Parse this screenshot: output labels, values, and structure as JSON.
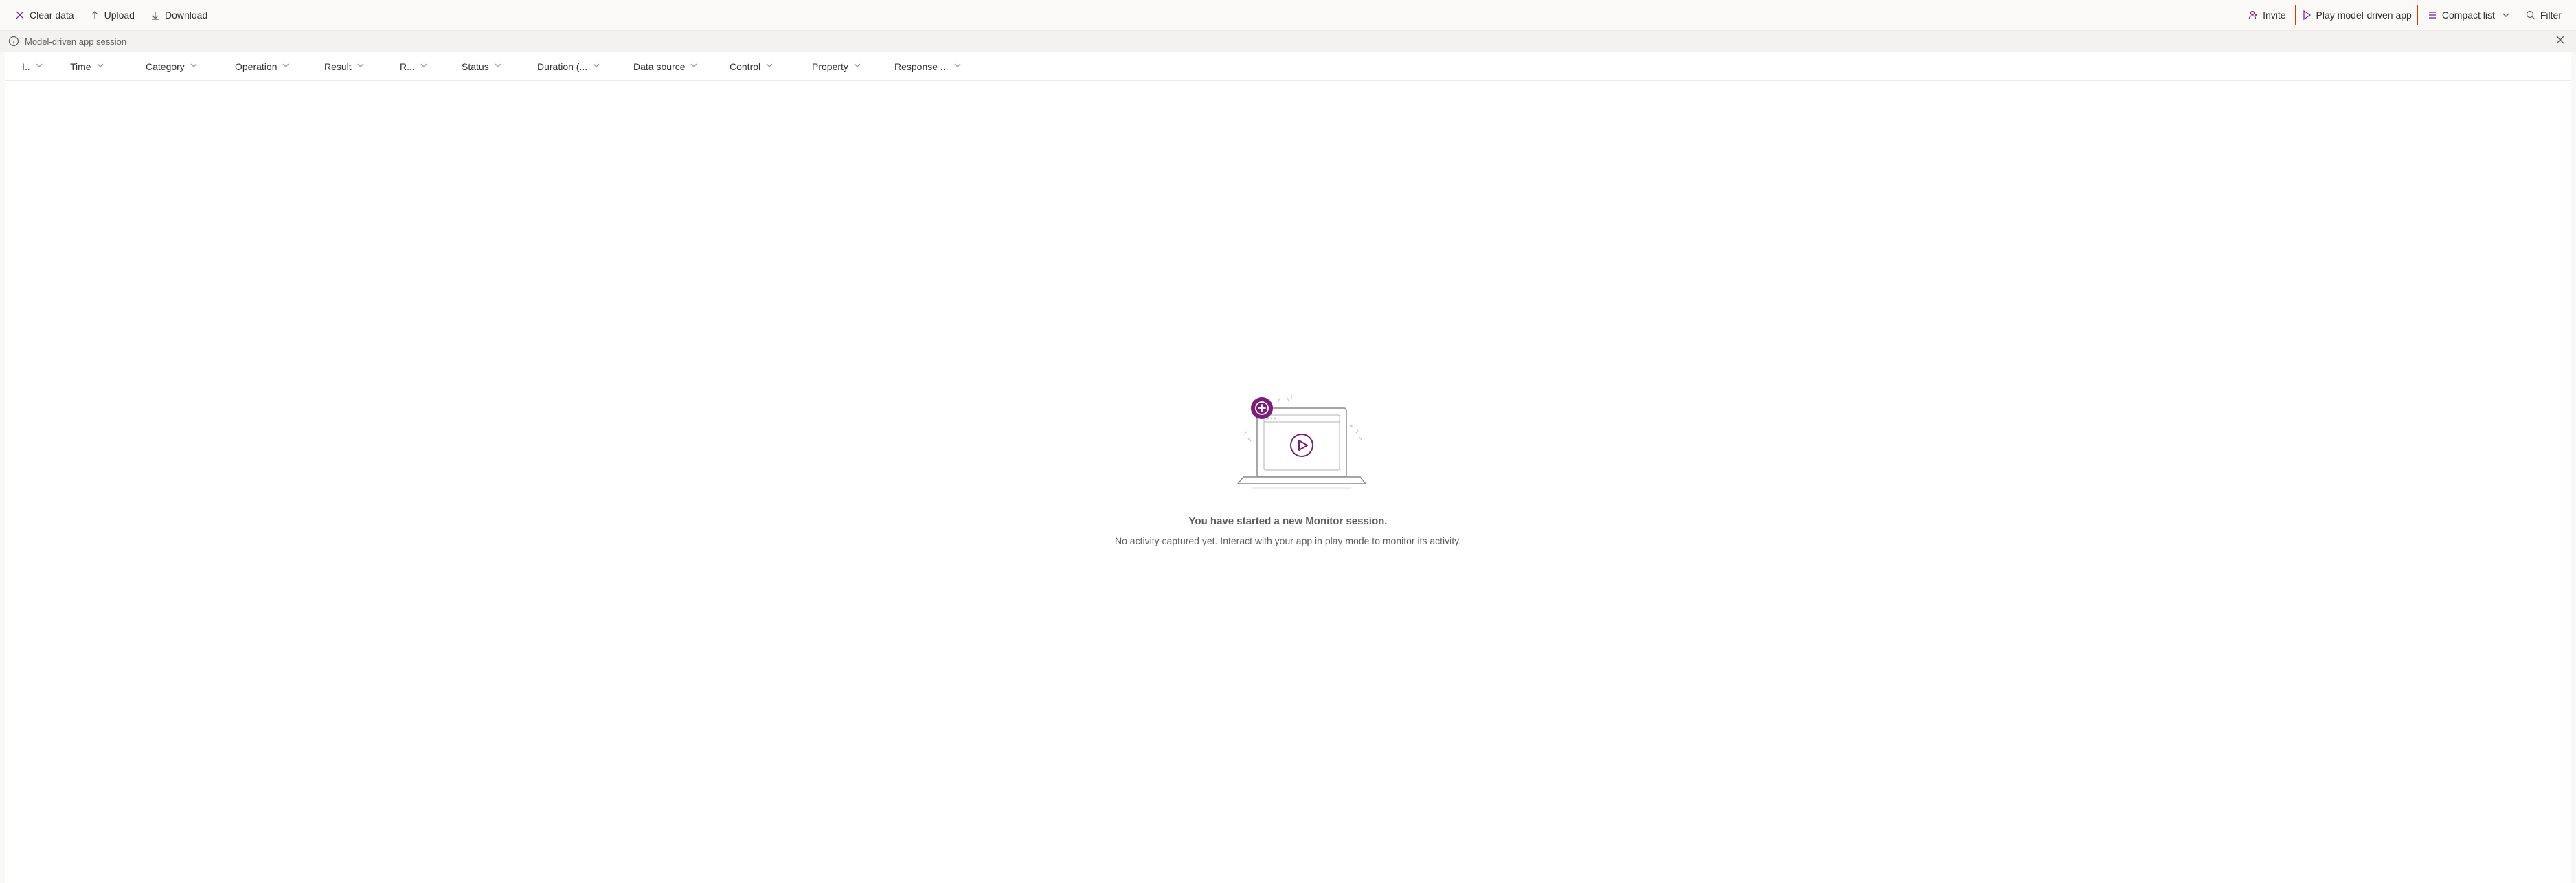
{
  "toolbar": {
    "clear_data": "Clear data",
    "upload": "Upload",
    "download": "Download",
    "invite": "Invite",
    "play": "Play model-driven app",
    "compact_list": "Compact list",
    "filter": "Filter"
  },
  "sessionbar": {
    "label": "Model-driven app session"
  },
  "columns": {
    "id": "I..",
    "time": "Time",
    "category": "Category",
    "operation": "Operation",
    "result": "Result",
    "r": "R...",
    "status": "Status",
    "duration": "Duration (...",
    "data_source": "Data source",
    "control": "Control",
    "property": "Property",
    "response": "Response ..."
  },
  "empty": {
    "title": "You have started a new Monitor session.",
    "subtitle": "No activity captured yet. Interact with your app in play mode to monitor its activity."
  }
}
